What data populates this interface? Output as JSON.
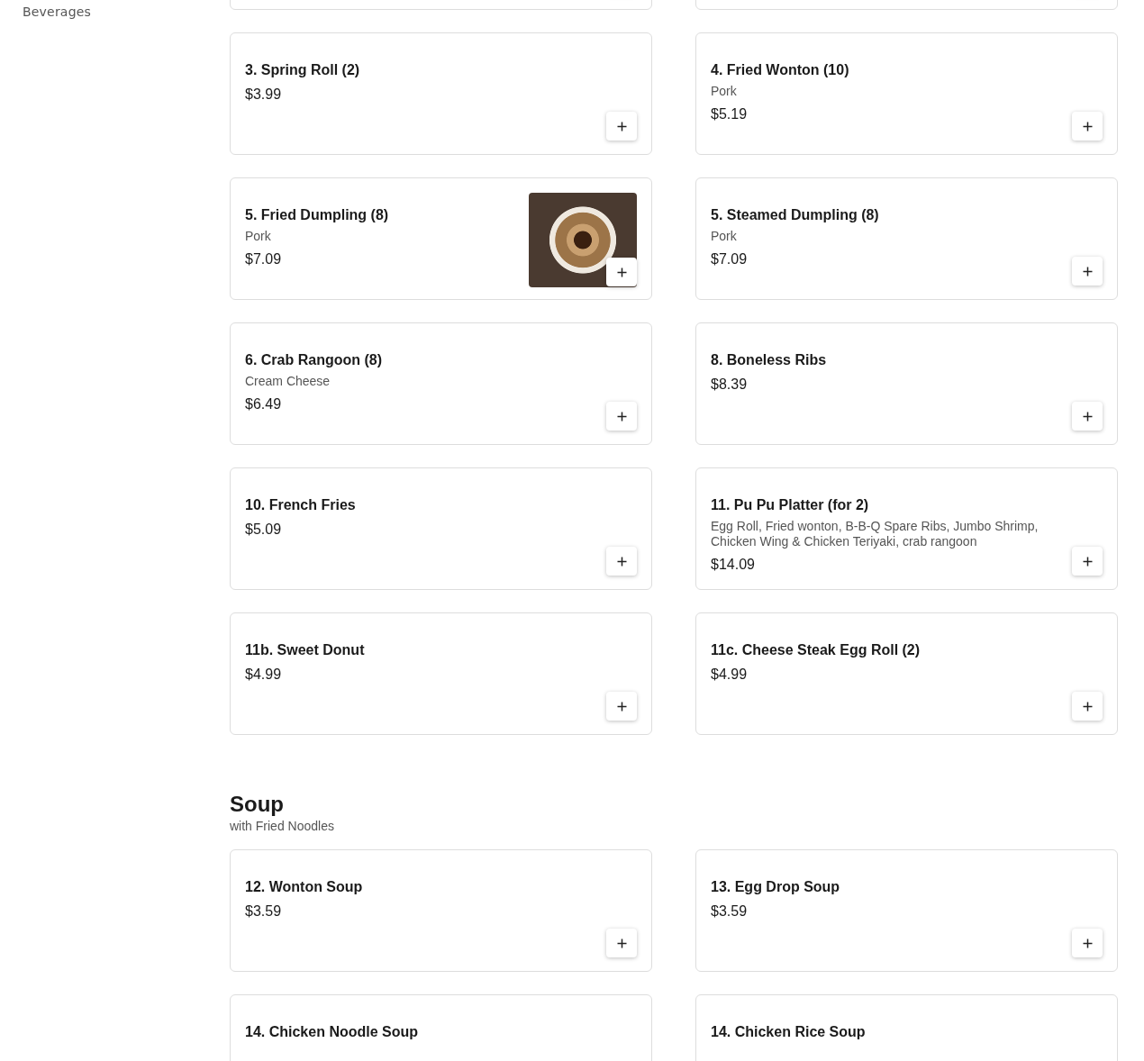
{
  "sidebar": {
    "items": [
      {
        "label": "Beverages"
      }
    ]
  },
  "sections": [
    {
      "clipped_row_above": true,
      "items": [
        {
          "kind": "item",
          "name": "3. Spring Roll (2)",
          "price": "$3.99"
        },
        {
          "kind": "item",
          "name": "4. Fried Wonton (10)",
          "description": "Pork",
          "price": "$5.19"
        },
        {
          "kind": "item",
          "name": "5. Fried Dumpling (8)",
          "description": "Pork",
          "price": "$7.09",
          "photo": true
        },
        {
          "kind": "item",
          "name": "5. Steamed Dumpling (8)",
          "description": "Pork",
          "price": "$7.09"
        },
        {
          "kind": "item",
          "name": "6. Crab Rangoon (8)",
          "description": "Cream Cheese",
          "price": "$6.49"
        },
        {
          "kind": "item",
          "name": "8. Boneless Ribs",
          "price": "$8.39"
        },
        {
          "kind": "item",
          "name": "10. French Fries",
          "price": "$5.09"
        },
        {
          "kind": "item",
          "name": "11. Pu Pu Platter (for 2)",
          "description": "Egg Roll, Fried wonton, B-B-Q Spare Ribs, Jumbo Shrimp, Chicken Wing & Chicken Teriyaki, crab rangoon",
          "price": "$14.09"
        },
        {
          "kind": "item",
          "name": "11b. Sweet Donut",
          "price": "$4.99"
        },
        {
          "kind": "item",
          "name": "11c. Cheese Steak Egg Roll (2)",
          "price": "$4.99"
        }
      ]
    },
    {
      "title": "Soup",
      "subtitle": "with Fried Noodles",
      "items": [
        {
          "kind": "item",
          "name": "12. Wonton Soup",
          "price": "$3.59"
        },
        {
          "kind": "item",
          "name": "13. Egg Drop Soup",
          "price": "$3.59"
        },
        {
          "kind": "item",
          "name": "14. Chicken Noodle Soup"
        },
        {
          "kind": "item",
          "name": "14. Chicken Rice Soup"
        }
      ]
    }
  ]
}
